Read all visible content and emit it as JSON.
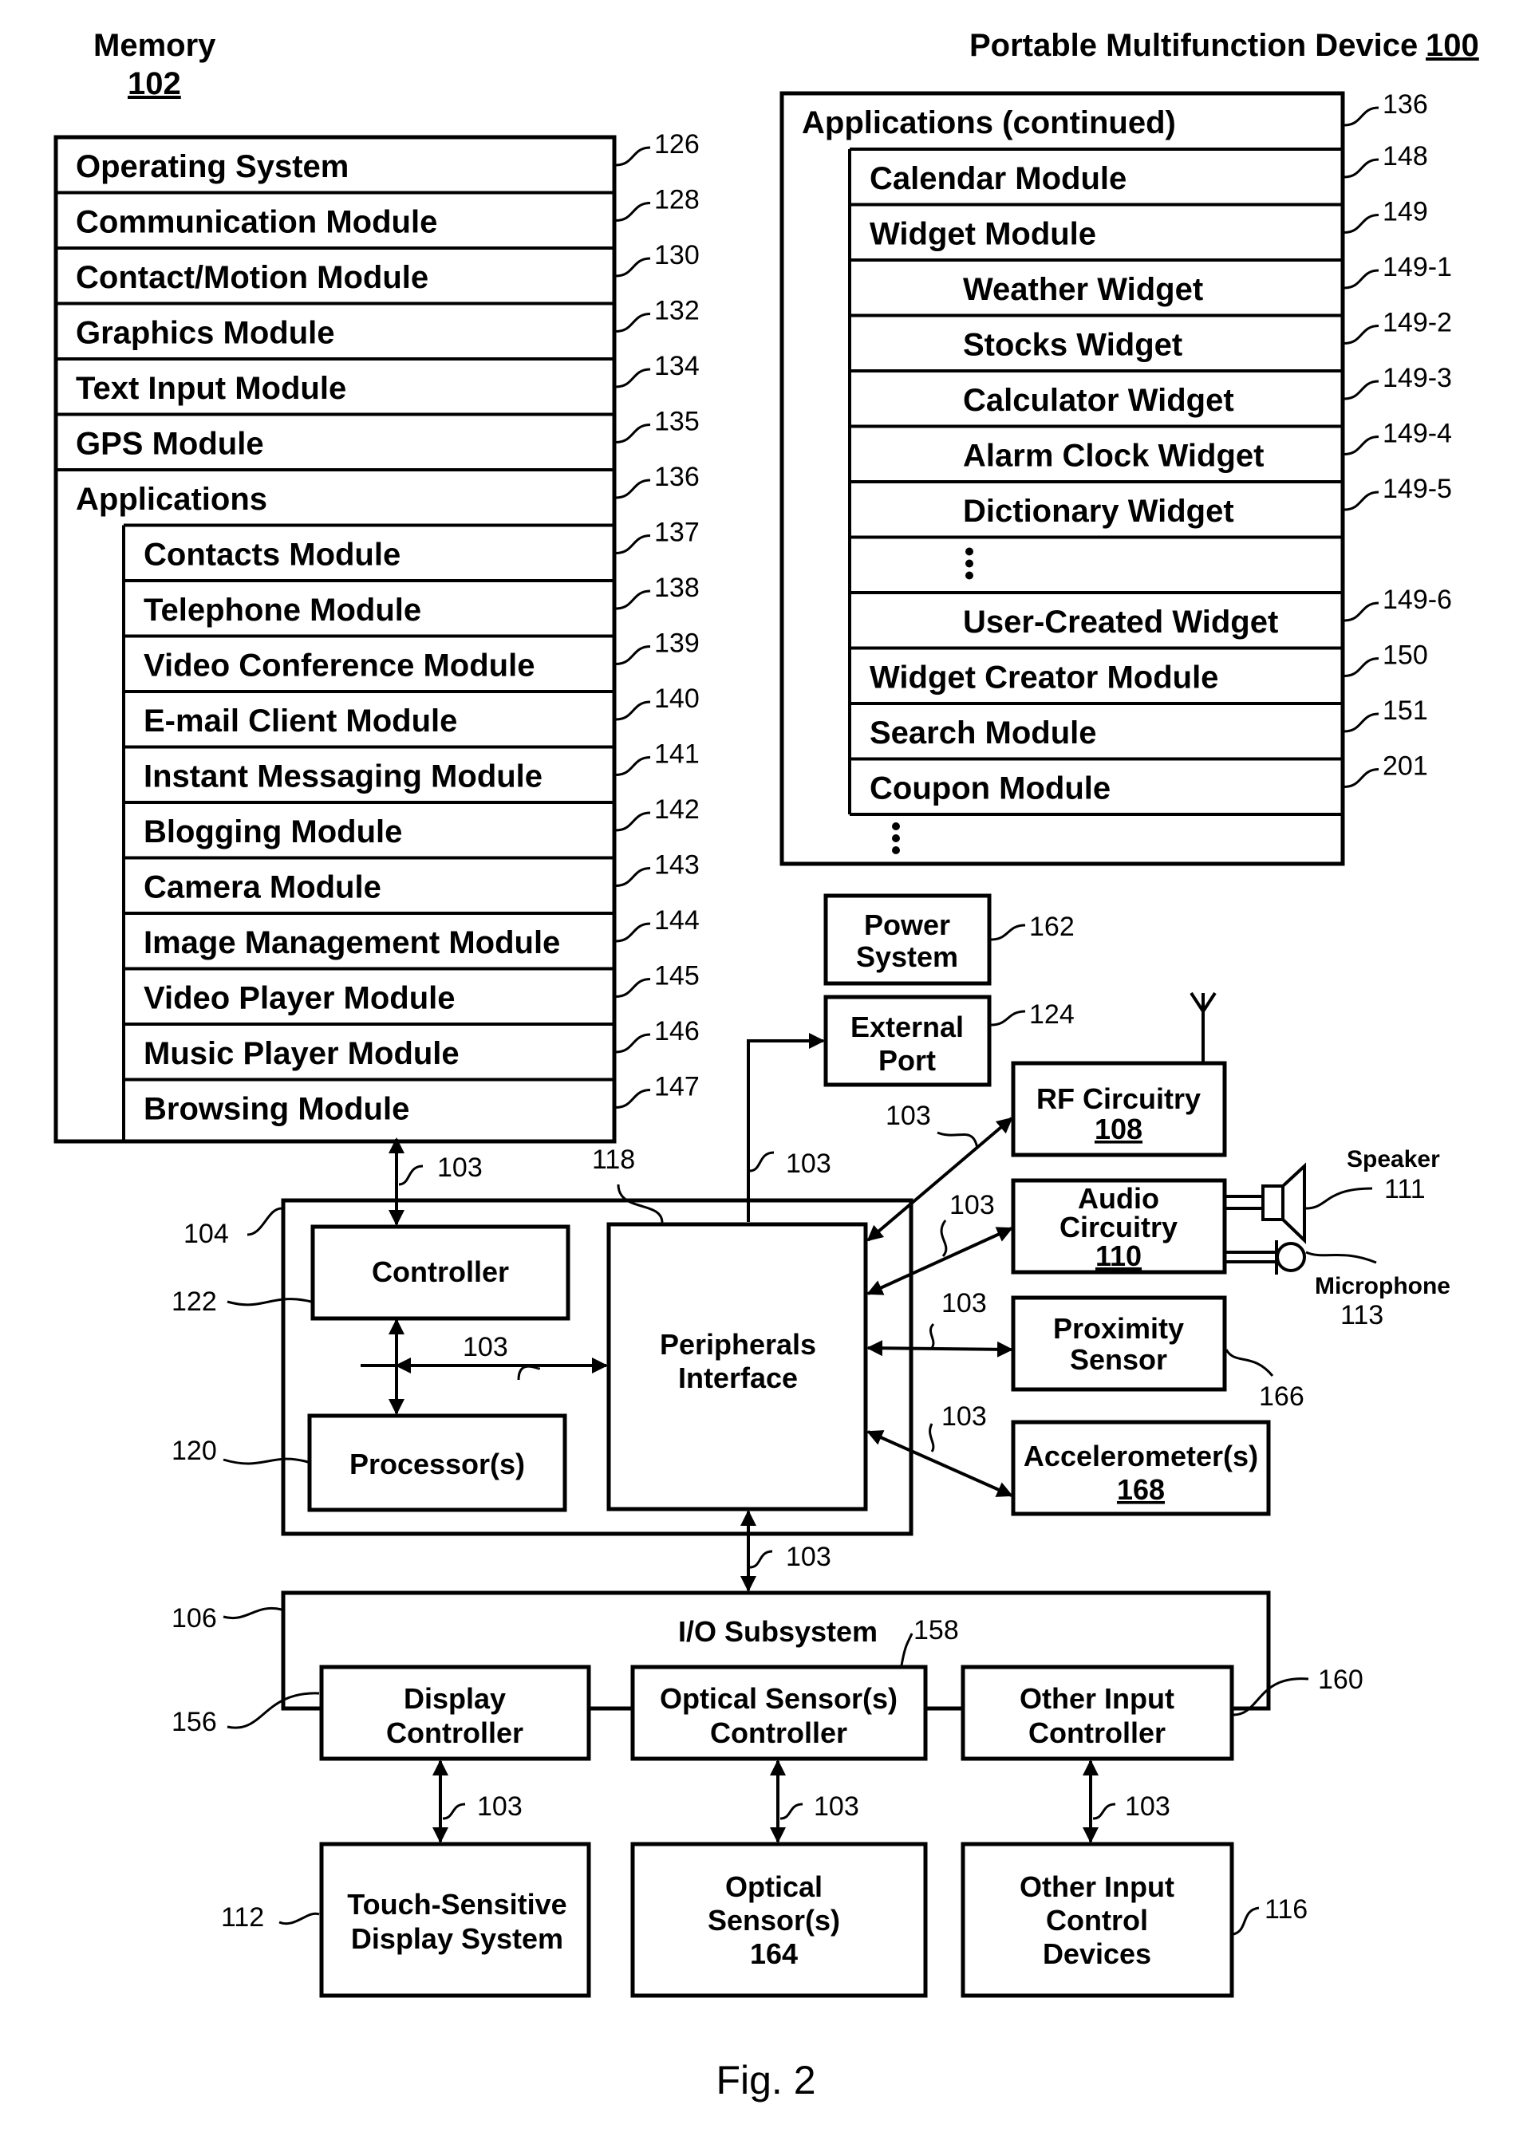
{
  "header": {
    "memory_title": "Memory",
    "memory_ref": "102",
    "device_title": "Portable Multifunction Device",
    "device_ref": "100"
  },
  "memory": {
    "items": [
      {
        "label": "Operating System",
        "ref": "126"
      },
      {
        "label": "Communication Module",
        "ref": "128"
      },
      {
        "label": "Contact/Motion Module",
        "ref": "130"
      },
      {
        "label": "Graphics Module",
        "ref": "132"
      },
      {
        "label": "Text Input Module",
        "ref": "134"
      },
      {
        "label": "GPS Module",
        "ref": "135"
      },
      {
        "label": "Applications",
        "ref": "136"
      }
    ],
    "apps": [
      {
        "label": "Contacts Module",
        "ref": "137"
      },
      {
        "label": "Telephone Module",
        "ref": "138"
      },
      {
        "label": "Video Conference Module",
        "ref": "139"
      },
      {
        "label": "E-mail Client Module",
        "ref": "140"
      },
      {
        "label": "Instant Messaging Module",
        "ref": "141"
      },
      {
        "label": "Blogging Module",
        "ref": "142"
      },
      {
        "label": "Camera Module",
        "ref": "143"
      },
      {
        "label": "Image Management Module",
        "ref": "144"
      },
      {
        "label": "Video Player Module",
        "ref": "145"
      },
      {
        "label": "Music Player Module",
        "ref": "146"
      },
      {
        "label": "Browsing Module",
        "ref": "147"
      }
    ]
  },
  "apps_continued": {
    "title": "Applications (continued)",
    "ref": "136",
    "items": [
      {
        "label": "Calendar Module",
        "ref": "148",
        "indent": false
      },
      {
        "label": "Widget Module",
        "ref": "149",
        "indent": false
      },
      {
        "label": "Weather Widget",
        "ref": "149-1",
        "indent": true
      },
      {
        "label": "Stocks Widget",
        "ref": "149-2",
        "indent": true
      },
      {
        "label": "Calculator Widget",
        "ref": "149-3",
        "indent": true
      },
      {
        "label": "Alarm Clock Widget",
        "ref": "149-4",
        "indent": true
      },
      {
        "label": "Dictionary Widget",
        "ref": "149-5",
        "indent": true
      },
      {
        "label": "",
        "ref": "",
        "indent": true,
        "ellipsis": true
      },
      {
        "label": "User-Created Widget",
        "ref": "149-6",
        "indent": true
      },
      {
        "label": "Widget Creator Module",
        "ref": "150",
        "indent": false
      },
      {
        "label": "Search Module",
        "ref": "151",
        "indent": false
      },
      {
        "label": "Coupon Module",
        "ref": "201",
        "indent": false
      }
    ]
  },
  "blocks": {
    "power": {
      "line1": "Power",
      "line2": "System",
      "ref": "162"
    },
    "external_port": {
      "line1": "External",
      "line2": "Port",
      "ref": "124"
    },
    "rf": {
      "line1": "RF Circuitry",
      "ref_inner": "108"
    },
    "audio": {
      "line1": "Audio",
      "line2": "Circuitry",
      "ref_inner": "110"
    },
    "speaker": {
      "label": "Speaker",
      "ref": "111"
    },
    "microphone": {
      "label": "Microphone",
      "ref": "113"
    },
    "proximity": {
      "line1": "Proximity",
      "line2": "Sensor",
      "ref": "166"
    },
    "accelerometer": {
      "line1": "Accelerometer(s)",
      "ref_inner": "168"
    },
    "chip": {
      "ref": "104"
    },
    "controller": {
      "label": "Controller",
      "ref": "122"
    },
    "processor": {
      "label": "Processor(s)",
      "ref": "120"
    },
    "peripherals": {
      "line1": "Peripherals",
      "line2": "Interface",
      "ref": "118"
    },
    "io": {
      "label": "I/O Subsystem",
      "ref": "106"
    },
    "display_ctrl": {
      "line1": "Display",
      "line2": "Controller",
      "ref": "156"
    },
    "optical_ctrl": {
      "line1": "Optical Sensor(s)",
      "line2": "Controller",
      "ref": "158"
    },
    "other_ctrl": {
      "line1": "Other Input",
      "line2": "Controller",
      "ref": "160"
    },
    "touch": {
      "line1": "Touch-Sensitive",
      "line2": "Display System",
      "ref": "112"
    },
    "optical": {
      "line1": "Optical",
      "line2": "Sensor(s)",
      "line3": "164"
    },
    "other_dev": {
      "line1": "Other Input",
      "line2": "Control",
      "line3": "Devices",
      "ref": "116"
    }
  },
  "bus_ref": "103",
  "figure_caption": "Fig. 2"
}
